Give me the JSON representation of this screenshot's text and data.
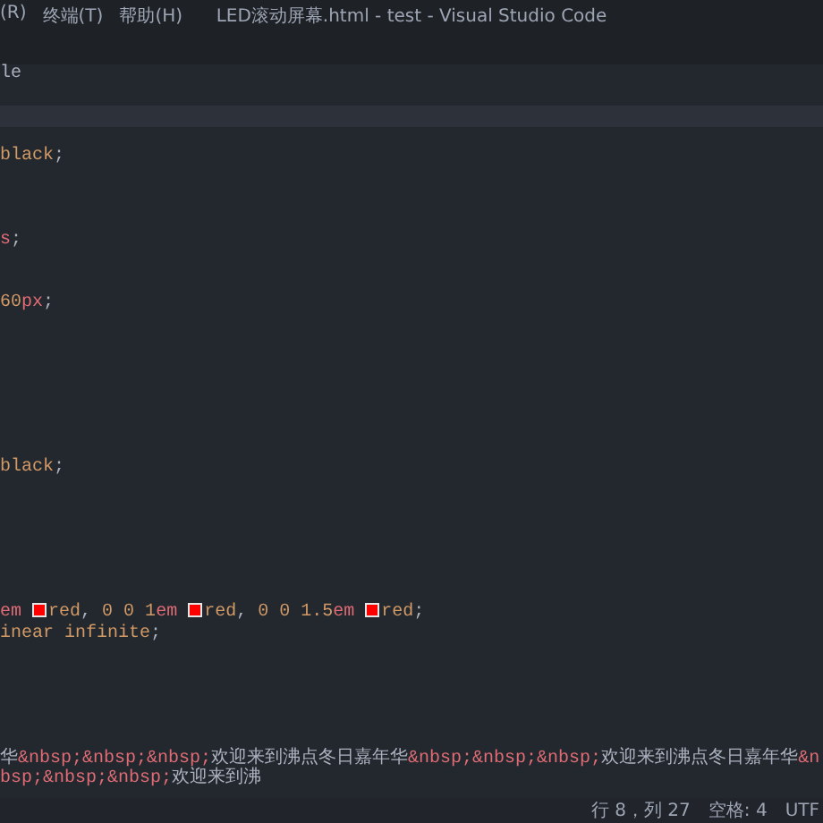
{
  "menu": [
    {
      "label": "(R)"
    },
    {
      "label": "终端(T)"
    },
    {
      "label": "帮助(H)"
    }
  ],
  "window": {
    "title": "LED滚动屏幕.html - test - Visual Studio Code"
  },
  "editor": {
    "lines": [
      {
        "kind": "code",
        "segments": [
          {
            "kind": "plain",
            "text": "le"
          }
        ]
      },
      {
        "kind": "blank"
      },
      {
        "kind": "current_line"
      },
      {
        "kind": "blank"
      },
      {
        "kind": "code",
        "segments": [
          {
            "kind": "value",
            "text": "black"
          },
          {
            "kind": "punct",
            "text": ";"
          }
        ]
      },
      {
        "kind": "blank"
      },
      {
        "kind": "blank"
      },
      {
        "kind": "blank"
      },
      {
        "kind": "code",
        "segments": [
          {
            "kind": "unit",
            "text": "s"
          },
          {
            "kind": "punct",
            "text": ";"
          }
        ]
      },
      {
        "kind": "blank"
      },
      {
        "kind": "blank"
      },
      {
        "kind": "code",
        "segments": [
          {
            "kind": "value",
            "text": "60"
          },
          {
            "kind": "unit",
            "text": "px"
          },
          {
            "kind": "punct",
            "text": ";"
          }
        ]
      },
      {
        "kind": "blank"
      },
      {
        "kind": "blank"
      },
      {
        "kind": "blank"
      },
      {
        "kind": "blank"
      },
      {
        "kind": "blank"
      },
      {
        "kind": "blank"
      },
      {
        "kind": "blank"
      },
      {
        "kind": "code",
        "segments": [
          {
            "kind": "value",
            "text": "black"
          },
          {
            "kind": "punct",
            "text": ";"
          }
        ]
      },
      {
        "kind": "blank"
      },
      {
        "kind": "blank"
      },
      {
        "kind": "blank"
      },
      {
        "kind": "blank"
      },
      {
        "kind": "blank"
      },
      {
        "kind": "blank"
      },
      {
        "kind": "code",
        "segments": [
          {
            "kind": "unit",
            "text": "em "
          },
          {
            "kind": "swatch",
            "color": "#ff0000"
          },
          {
            "kind": "value",
            "text": "red"
          },
          {
            "kind": "punct",
            "text": ", "
          },
          {
            "kind": "value",
            "text": "0 0 1"
          },
          {
            "kind": "unit",
            "text": "em "
          },
          {
            "kind": "swatch",
            "color": "#ff0000"
          },
          {
            "kind": "value",
            "text": "red"
          },
          {
            "kind": "punct",
            "text": ", "
          },
          {
            "kind": "value",
            "text": "0 0 1.5"
          },
          {
            "kind": "unit",
            "text": "em "
          },
          {
            "kind": "swatch",
            "color": "#ff0000"
          },
          {
            "kind": "value",
            "text": "red"
          },
          {
            "kind": "punct",
            "text": ";"
          }
        ]
      },
      {
        "kind": "code",
        "segments": [
          {
            "kind": "value",
            "text": "inear infinite"
          },
          {
            "kind": "punct",
            "text": ";"
          }
        ]
      },
      {
        "kind": "blank"
      },
      {
        "kind": "blank"
      },
      {
        "kind": "blank"
      },
      {
        "kind": "blank"
      },
      {
        "kind": "blank"
      },
      {
        "kind": "code",
        "segments": [
          {
            "kind": "plain",
            "text": "华"
          },
          {
            "kind": "unit",
            "text": "&nbsp;&nbsp;&nbsp;"
          },
          {
            "kind": "plain",
            "text": "欢迎来到沸点冬日嘉年华"
          },
          {
            "kind": "unit",
            "text": "&nbsp;&nbsp;&nbsp;"
          },
          {
            "kind": "plain",
            "text": "欢迎来到沸点冬日嘉年华"
          },
          {
            "kind": "unit",
            "text": "&nbsp;&nbsp;&nbsp;"
          },
          {
            "kind": "plain",
            "text": "欢迎来到沸"
          }
        ]
      }
    ]
  },
  "status_bar": {
    "items": [
      {
        "label": "行 8，列 27"
      },
      {
        "label": "空格: 4"
      },
      {
        "label": "UTF"
      }
    ]
  }
}
